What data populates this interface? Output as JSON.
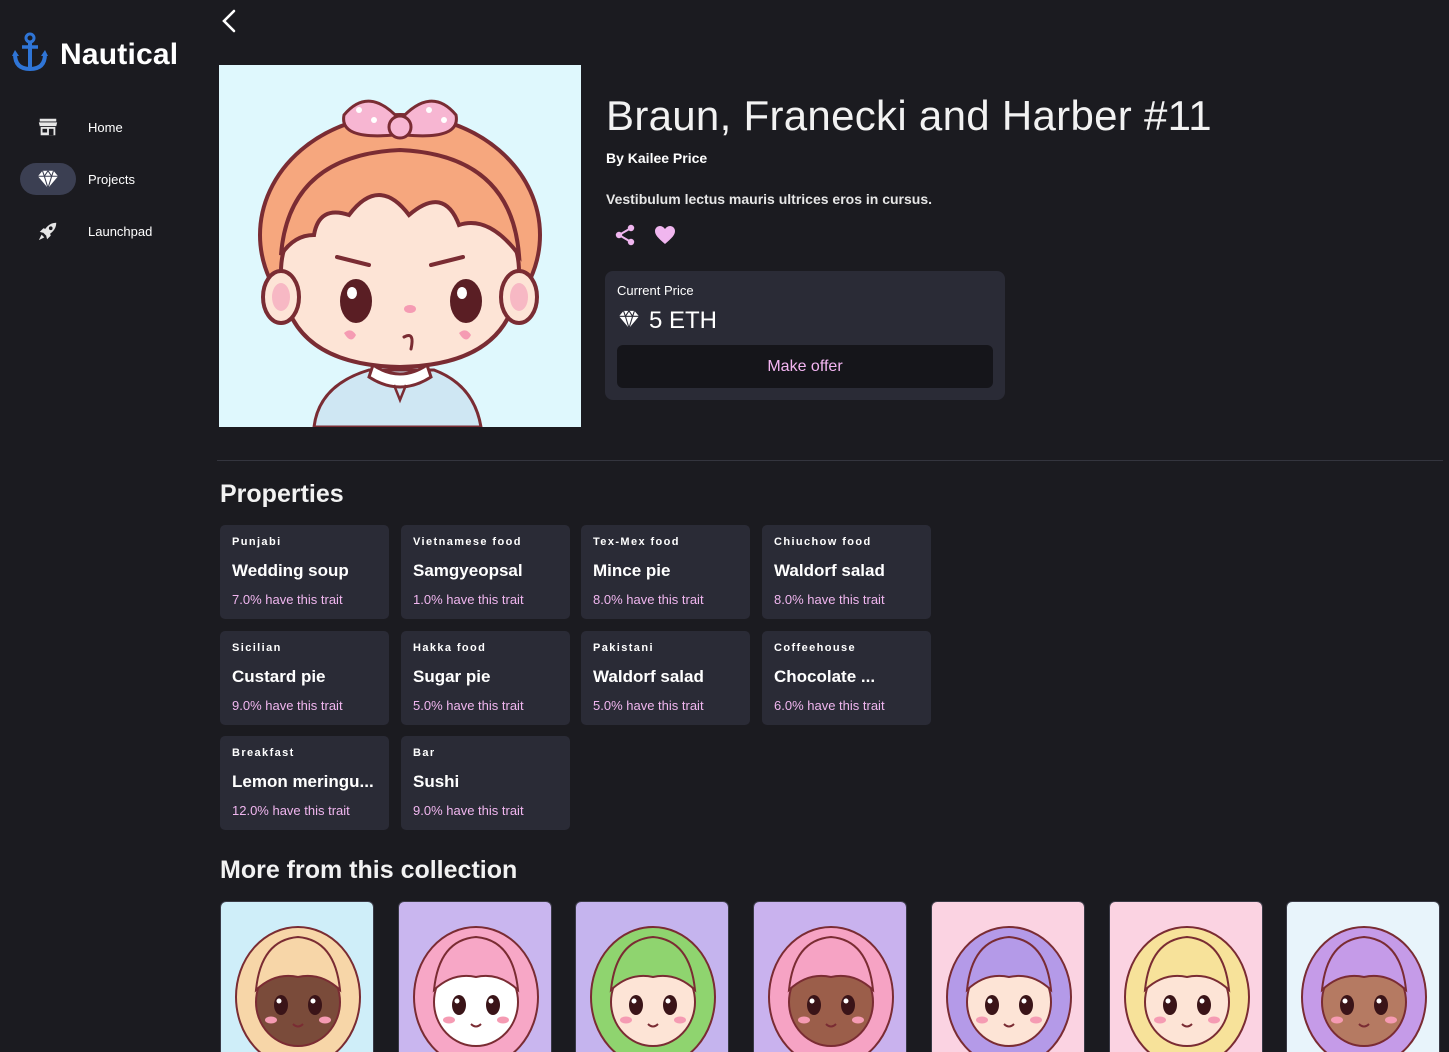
{
  "app": {
    "brand": "Nautical",
    "colors": {
      "background": "#1b1b20",
      "card": "#2a2b36",
      "accent_pink": "#f0b6ef",
      "logo_blue": "#2f75d6",
      "active_nav": "#3b3f52"
    }
  },
  "sidebar": {
    "items": [
      {
        "label": "Home",
        "icon": "storefront-icon",
        "active": false
      },
      {
        "label": "Projects",
        "icon": "diamond-icon",
        "active": true
      },
      {
        "label": "Launchpad",
        "icon": "rocket-icon",
        "active": false
      }
    ]
  },
  "nft": {
    "title": "Braun, Franecki and Harber #11",
    "byline": "By Kailee Price",
    "description": "Vestibulum lectus mauris ultrices eros in cursus.",
    "actions": [
      "share-icon",
      "heart-icon"
    ]
  },
  "price": {
    "label": "Current Price",
    "value": "5 ETH",
    "currency_icon": "diamond-icon",
    "button_label": "Make offer"
  },
  "properties": {
    "title": "Properties",
    "items": [
      {
        "type": "Punjabi",
        "value": "Wedding soup",
        "rarity": "7.0% have this trait"
      },
      {
        "type": "Vietnamese food",
        "value": "Samgyeopsal",
        "rarity": "1.0% have this trait"
      },
      {
        "type": "Tex-Mex food",
        "value": "Mince pie",
        "rarity": "8.0% have this trait"
      },
      {
        "type": "Chiuchow food",
        "value": "Waldorf salad",
        "rarity": "8.0% have this trait"
      },
      {
        "type": "Sicilian",
        "value": "Custard pie",
        "rarity": "9.0% have this trait"
      },
      {
        "type": "Hakka food",
        "value": "Sugar pie",
        "rarity": "5.0% have this trait"
      },
      {
        "type": "Pakistani",
        "value": "Waldorf salad",
        "rarity": "5.0% have this trait"
      },
      {
        "type": "Coffeehouse",
        "value": "Chocolate ...",
        "rarity": "6.0% have this trait"
      },
      {
        "type": "Breakfast",
        "value": "Lemon meringu...",
        "rarity": "12.0% have this trait"
      },
      {
        "type": "Bar",
        "value": "Sushi",
        "rarity": "9.0% have this trait"
      }
    ]
  },
  "collection": {
    "title": "More from this collection",
    "items": [
      {
        "bg": "#cfeef9",
        "hair": "#f7d6a8",
        "skin": "#7a4b3a"
      },
      {
        "bg": "#c9b6ef",
        "hair": "#f7a7c6",
        "skin": "#ffffff"
      },
      {
        "bg": "#c5b4ee",
        "hair": "#8fd46f",
        "skin": "#fde4d6"
      },
      {
        "bg": "#c9b2ee",
        "hair": "#f6a3c4",
        "skin": "#9b5e4a"
      },
      {
        "bg": "#fbd3e2",
        "hair": "#b49ae8",
        "skin": "#fde4d6"
      },
      {
        "bg": "#fbd3e2",
        "hair": "#f7e29a",
        "skin": "#fde4d6"
      },
      {
        "bg": "#e8f4fb",
        "hair": "#c59be8",
        "skin": "#b57a62"
      }
    ]
  }
}
